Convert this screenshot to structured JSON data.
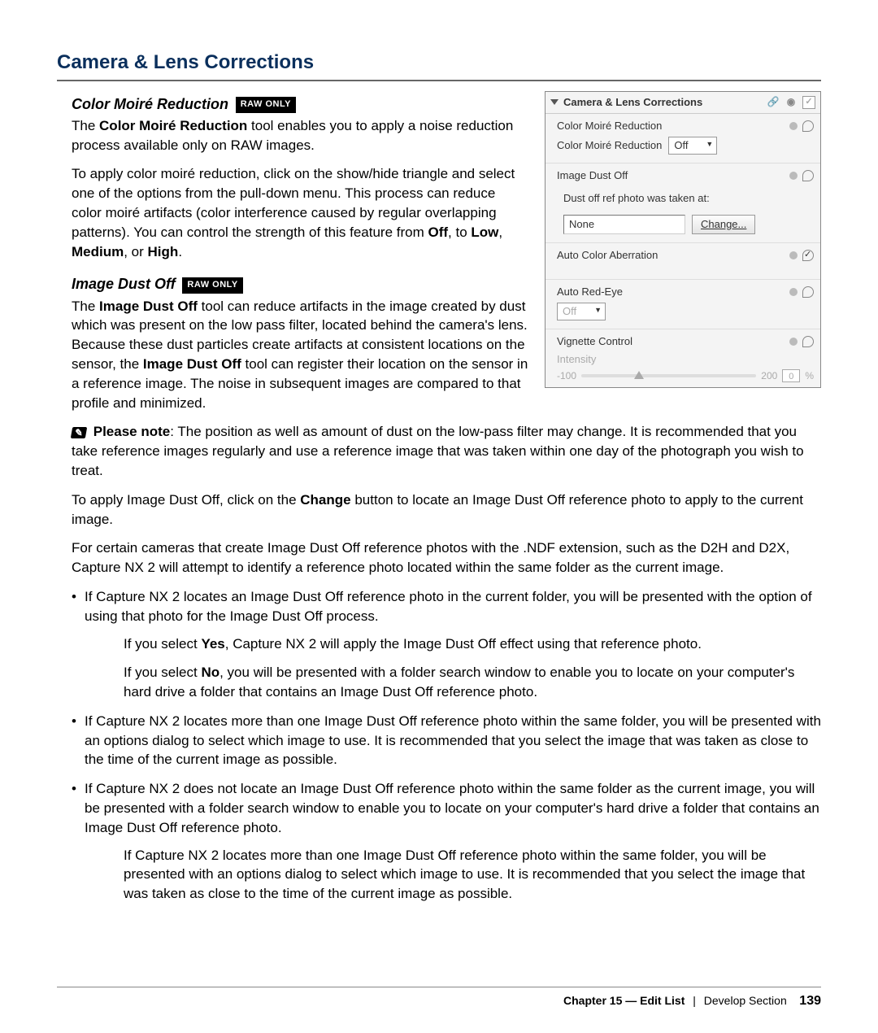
{
  "heading": "Camera & Lens Corrections",
  "raw_only_label": "RAW ONLY",
  "color_moire": {
    "title": "Color Moiré Reduction",
    "p1_a": "The ",
    "p1_b": "Color Moiré Reduction",
    "p1_c": " tool enables you to apply a noise reduction process available only on RAW images.",
    "p2_a": "To apply color moiré reduction, click on the show/hide triangle and select one of the options from the pull-down menu. This process can reduce color moiré artifacts (color interference caused by regular overlapping patterns). You can control the strength of this feature from ",
    "p2_off": "Off",
    "p2_b": ", to ",
    "p2_low": "Low",
    "p2_c": ", ",
    "p2_med": "Medium",
    "p2_d": ", or ",
    "p2_high": "High",
    "p2_e": "."
  },
  "image_dust": {
    "title": "Image Dust Off",
    "p1_a": "The ",
    "p1_b": "Image Dust Off",
    "p1_c": " tool can reduce artifacts in the image created by dust which was present on the low pass filter, located behind the camera's lens. Because these dust particles create artifacts at consistent locations on the sensor, the ",
    "p1_d": "Image Dust Off",
    "p1_e": " tool can register their location on the sensor in a reference image. The noise in subsequent images are compared to that profile and minimized."
  },
  "note": {
    "lead": "Please note",
    "text": ": The position as well as amount of dust on the low-pass filter may change. It is recommended that you take reference images regularly and use a reference image that was taken within one day of the photograph you wish to treat."
  },
  "apply_a": "To apply Image Dust Off, click on the ",
  "apply_change": "Change",
  "apply_b": " button to locate an Image Dust Off reference photo to apply to the current image.",
  "certain": "For certain cameras that create Image Dust Off reference photos with the .NDF extension, such as the D2H and D2X, Capture NX 2 will attempt to identify a reference photo located within the same folder as the current image.",
  "bullets": {
    "b1": "If Capture NX 2 locates an Image Dust Off reference photo in the current folder, you will be presented with the option of using that photo for the Image Dust Off process.",
    "b1_yes_a": "If you select ",
    "b1_yes_b": "Yes",
    "b1_yes_c": ", Capture NX 2 will apply the Image Dust Off effect using that reference photo.",
    "b1_no_a": "If you select ",
    "b1_no_b": "No",
    "b1_no_c": ", you will be presented with a folder search window to enable you to locate on your computer's hard drive a folder that contains an Image Dust Off reference photo.",
    "b2": "If Capture NX 2 locates more than one Image Dust Off reference photo within the same folder, you will be presented with an options dialog to select which image to use. It is recommended that you select the image that was taken as close to the time of the current image as possible.",
    "b3": "If Capture NX 2 does not locate an Image Dust Off reference photo within the same folder as the current image, you will be presented with a folder search window to enable you to locate on your computer's hard drive a folder that contains an Image Dust Off reference photo.",
    "b3_sub": "If Capture NX 2 locates more than one Image Dust Off reference photo within the same folder, you will be presented with an options dialog to select which image to use. It is recommended that you select the image that was taken as close to the time of the current image as possible."
  },
  "panel": {
    "title": "Camera & Lens Corrections",
    "s1": "Color Moiré Reduction",
    "s1b_label": "Color Moiré Reduction",
    "s1b_value": "Off",
    "s2": "Image Dust Off",
    "s2_sub": "Dust off ref photo was taken at:",
    "s2_input": "None",
    "s2_btn": "Change...",
    "s3": "Auto Color Aberration",
    "s4": "Auto Red-Eye",
    "s4_value": "Off",
    "s5": "Vignette Control",
    "s5_label": "Intensity",
    "s5_min": "-100",
    "s5_max": "200",
    "s5_val": "0",
    "s5_unit": "%"
  },
  "footer": {
    "chapter": "Chapter 15 — Edit List",
    "section": "Develop Section",
    "page": "139"
  }
}
